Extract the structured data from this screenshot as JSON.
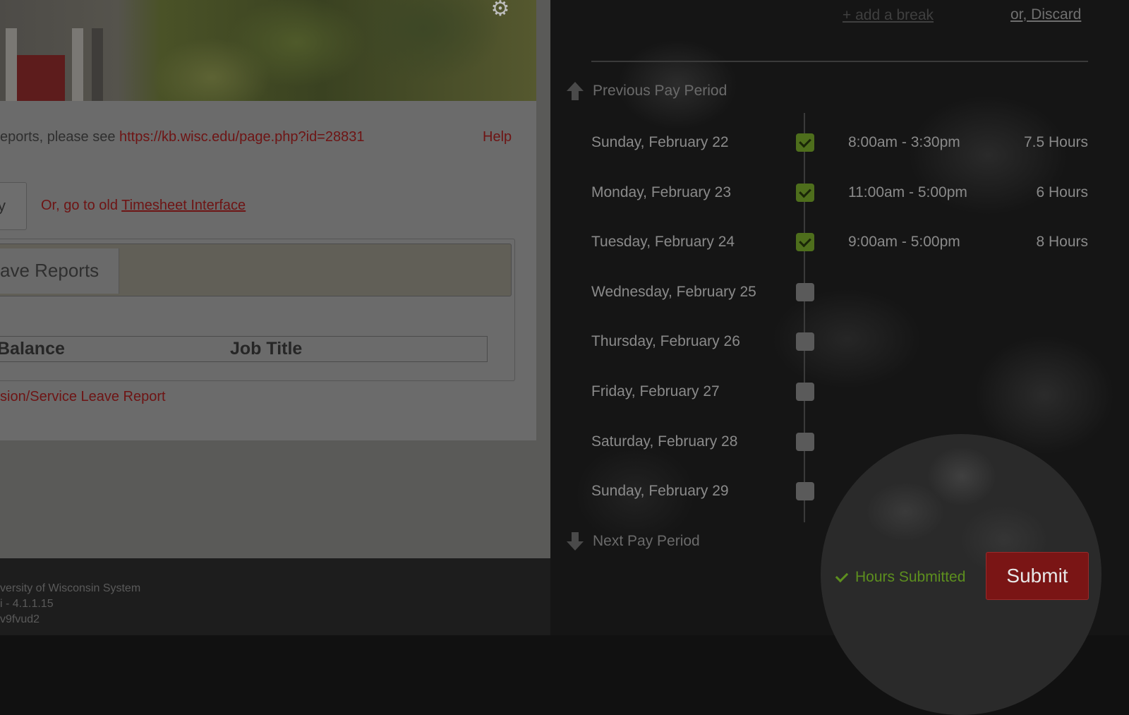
{
  "left_panel": {
    "info_text": "eports, please see",
    "kb_link": "https://kb.wisc.edu/page.php?id=28831",
    "help_link": "Help",
    "partial_button_label": "y",
    "old_interface_prefix": "Or, go to old",
    "old_interface_link": "Timesheet Interface",
    "tab_leave_reports": "ave Reports",
    "table_headers": [
      "Balance",
      "Job Title"
    ],
    "leave_report_link": "sion/Service Leave Report",
    "footer_lines": [
      "versity of Wisconsin System",
      "i - 4.1.1.15",
      "v9fvud2"
    ]
  },
  "timesheet": {
    "add_break_link": "+ add a break",
    "discard_link": "or, Discard",
    "previous_period": "Previous Pay Period",
    "next_period": "Next Pay Period",
    "days": [
      {
        "label": "Sunday, February 22",
        "checked": true,
        "time": "8:00am - 3:30pm",
        "hours": "7.5 Hours"
      },
      {
        "label": "Monday, February 23",
        "checked": true,
        "time": "11:00am - 5:00pm",
        "hours": "6 Hours"
      },
      {
        "label": "Tuesday, February 24",
        "checked": true,
        "time": "9:00am - 5:00pm",
        "hours": "8 Hours"
      },
      {
        "label": "Wednesday, February 25",
        "checked": false,
        "time": "",
        "hours": ""
      },
      {
        "label": "Thursday, February 26",
        "checked": false,
        "time": "",
        "hours": ""
      },
      {
        "label": "Friday, February 27",
        "checked": false,
        "time": "",
        "hours": ""
      },
      {
        "label": "Saturday, February 28",
        "checked": false,
        "time": "",
        "hours": ""
      },
      {
        "label": "Sunday, February 29",
        "checked": false,
        "time": "",
        "hours": ""
      }
    ],
    "status_text": "Hours Submitted",
    "submit_label": "Submit"
  },
  "colors": {
    "accent_red": "#7a1515",
    "success_green": "#5d8f1e",
    "check_green": "#4e6e1c"
  },
  "icons": {
    "gear": "gear-icon",
    "arrow_up": "arrow-up-icon",
    "arrow_down": "arrow-down-icon",
    "check": "checkmark-icon"
  }
}
